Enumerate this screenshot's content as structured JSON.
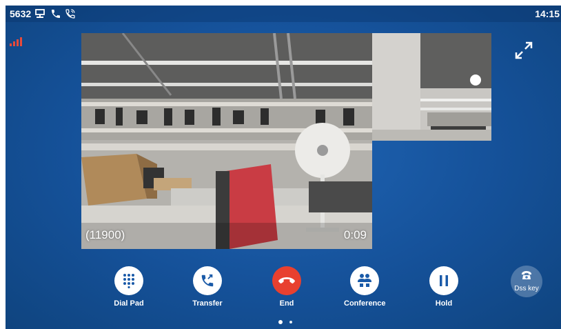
{
  "status_bar": {
    "extension": "5632",
    "icons": [
      "network-icon",
      "phone-icon",
      "phone-call-icon"
    ],
    "time": "14:15"
  },
  "signal": {
    "icon": "signal-bars-icon",
    "level_fraction": 1.0,
    "color": "#e84a3a"
  },
  "call": {
    "caller_number": "(11900)",
    "duration": "0:09"
  },
  "controls": {
    "buttons": [
      {
        "id": "dial-pad",
        "label": "Dial Pad",
        "icon": "dialpad-icon"
      },
      {
        "id": "transfer",
        "label": "Transfer",
        "icon": "transfer-call-icon"
      },
      {
        "id": "end",
        "label": "End",
        "icon": "hangup-icon",
        "color": "#e8402f"
      },
      {
        "id": "conference",
        "label": "Conference",
        "icon": "conference-icon"
      },
      {
        "id": "hold",
        "label": "Hold",
        "icon": "pause-icon"
      }
    ]
  },
  "dss_key": {
    "label": "Dss key",
    "icon": "desk-phone-icon"
  },
  "pager": {
    "pages": 2,
    "current": 1
  },
  "colors": {
    "background": "#155199",
    "end_button": "#e8402f",
    "signal": "#e84a3a"
  }
}
